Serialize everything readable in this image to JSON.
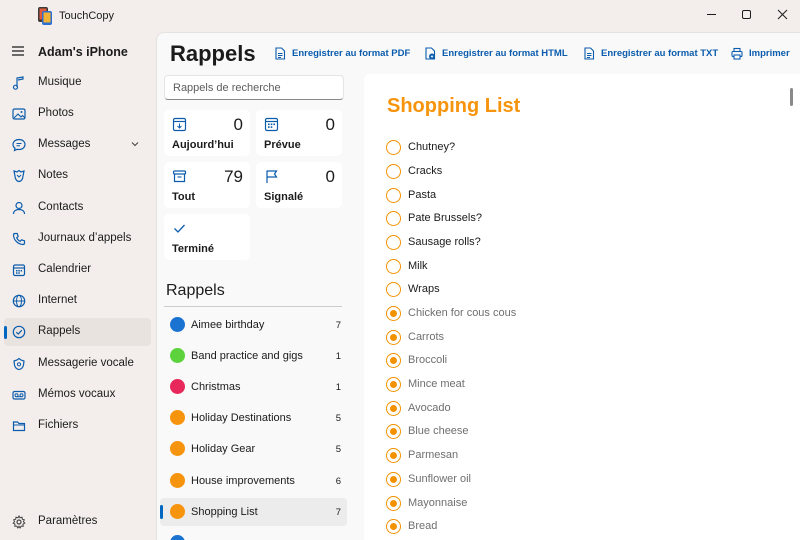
{
  "window": {
    "app_title": "TouchCopy",
    "controls": [
      "minimize-icon",
      "maximize-icon",
      "close-icon"
    ]
  },
  "sidebar": {
    "device_name": "Adam's iPhone",
    "items": [
      {
        "label": "Musique",
        "icon": "music-note-icon"
      },
      {
        "label": "Photos",
        "icon": "photo-icon"
      },
      {
        "label": "Messages",
        "icon": "chat-bubble-icon",
        "expandable": true
      },
      {
        "label": "Notes",
        "icon": "notes-icon"
      },
      {
        "label": "Contacts",
        "icon": "person-icon"
      },
      {
        "label": "Journaux d’appels",
        "icon": "phone-icon"
      },
      {
        "label": "Calendrier",
        "icon": "calendar-icon"
      },
      {
        "label": "Internet",
        "icon": "globe-icon"
      },
      {
        "label": "Rappels",
        "icon": "reminders-icon",
        "active": true
      },
      {
        "label": "Messagerie vocale",
        "icon": "voicemail-icon"
      },
      {
        "label": "Mémos vocaux",
        "icon": "voice-memo-icon"
      },
      {
        "label": "Fichiers",
        "icon": "folder-icon"
      }
    ],
    "settings_label": "Paramètres"
  },
  "header": {
    "title": "Rappels",
    "actions": [
      {
        "label": "Enregistrer au format PDF",
        "icon": "pdf-document-icon"
      },
      {
        "label": "Enregistrer au format HTML",
        "icon": "html-document-icon"
      },
      {
        "label": "Enregistrer au format TXT",
        "icon": "txt-document-icon"
      },
      {
        "label": "Imprimer",
        "icon": "printer-icon"
      }
    ]
  },
  "search": {
    "placeholder": "Rappels de recherche"
  },
  "smart_lists": [
    {
      "label": "Aujourd’hui",
      "count": "0",
      "icon": "calendar-today-icon"
    },
    {
      "label": "Prévue",
      "count": "0",
      "icon": "calendar-grid-icon"
    },
    {
      "label": "Tout",
      "count": "79",
      "icon": "tray-icon"
    },
    {
      "label": "Signalé",
      "count": "0",
      "icon": "flag-icon"
    },
    {
      "label": "Terminé",
      "count": "",
      "icon": "checkmark-icon"
    }
  ],
  "lists": {
    "heading": "Rappels",
    "items": [
      {
        "name": "Aimee birthday",
        "count": "7",
        "color": "#1a73d1"
      },
      {
        "name": "Band practice and gigs",
        "count": "1",
        "color": "#5cd33c"
      },
      {
        "name": "Christmas",
        "count": "1",
        "color": "#e8275b"
      },
      {
        "name": "Holiday Destinations",
        "count": "5",
        "color": "#f7940d"
      },
      {
        "name": "Holiday Gear",
        "count": "5",
        "color": "#f7940d"
      },
      {
        "name": "House improvements",
        "count": "6",
        "color": "#f7940d"
      },
      {
        "name": "Shopping List",
        "count": "7",
        "color": "#f7940d",
        "active": true
      }
    ]
  },
  "detail": {
    "title": "Shopping List",
    "accent_color": "#f7940d",
    "items": [
      {
        "text": "Chutney?",
        "completed": false
      },
      {
        "text": "Cracks",
        "completed": false
      },
      {
        "text": "Pasta",
        "completed": false
      },
      {
        "text": "Pate Brussels?",
        "completed": false
      },
      {
        "text": "Sausage rolls?",
        "completed": false
      },
      {
        "text": "Milk",
        "completed": false
      },
      {
        "text": "Wraps",
        "completed": false
      },
      {
        "text": "Chicken for cous cous",
        "completed": true
      },
      {
        "text": "Carrots",
        "completed": true
      },
      {
        "text": "Broccoli",
        "completed": true
      },
      {
        "text": "Mince meat",
        "completed": true
      },
      {
        "text": "Avocado",
        "completed": true
      },
      {
        "text": "Blue cheese",
        "completed": true
      },
      {
        "text": "Parmesan",
        "completed": true
      },
      {
        "text": "Sunflower oil",
        "completed": true
      },
      {
        "text": "Mayonnaise",
        "completed": true
      },
      {
        "text": "Bread",
        "completed": true
      }
    ]
  }
}
